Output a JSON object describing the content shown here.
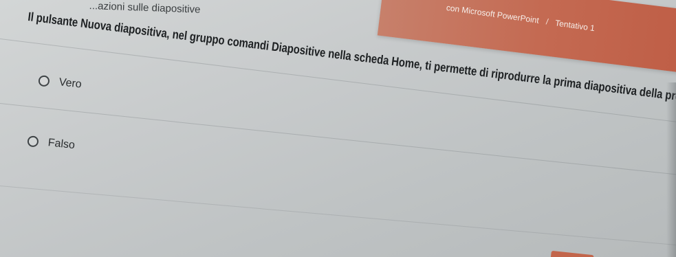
{
  "header": {
    "app_text": "con Microsoft PowerPoint",
    "separator": "/",
    "attempt_label": "Tentativo 1"
  },
  "breadcrumb": {
    "section_title": "...azioni sulle diapositive"
  },
  "question": {
    "text": "Il pulsante Nuova diapositiva, nel gruppo comandi Diapositive nella scheda Home, ti permette di riprodurre la prima diapositiva della presentazione"
  },
  "options": [
    {
      "label": "Vero",
      "selected": false
    },
    {
      "label": "Falso",
      "selected": false
    }
  ],
  "colors": {
    "accent": "#c46a52",
    "background": "#c8cbcc",
    "text": "#1e2123"
  }
}
